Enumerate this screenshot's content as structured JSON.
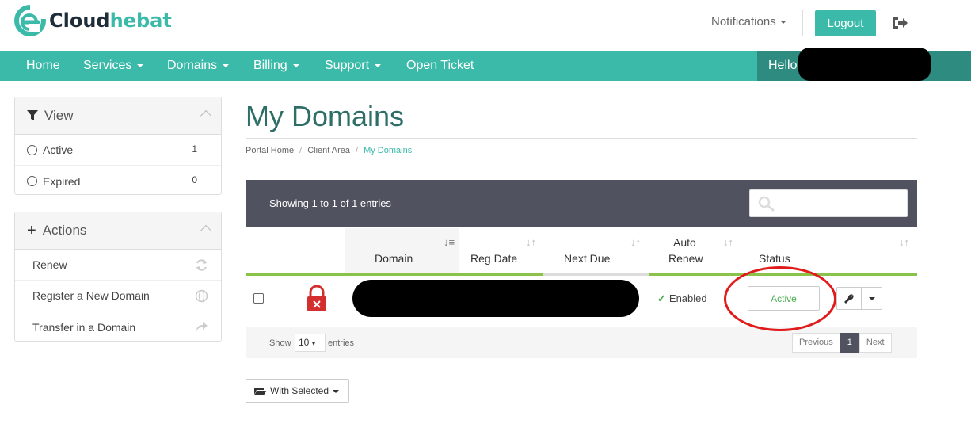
{
  "brand": {
    "name_a": "Cloud",
    "name_b": "hebat"
  },
  "header": {
    "notifications_label": "Notifications",
    "logout_label": "Logout"
  },
  "nav": {
    "items": [
      "Home",
      "Services",
      "Domains",
      "Billing",
      "Support",
      "Open Ticket"
    ],
    "hello_label": "Hello"
  },
  "sidebar": {
    "view": {
      "title": "View",
      "items": [
        {
          "label": "Active",
          "count": "1"
        },
        {
          "label": "Expired",
          "count": "0"
        }
      ]
    },
    "actions": {
      "title": "Actions",
      "items": [
        {
          "label": "Renew",
          "icon": "refresh-icon"
        },
        {
          "label": "Register a New Domain",
          "icon": "globe-icon"
        },
        {
          "label": "Transfer in a Domain",
          "icon": "share-icon"
        }
      ]
    }
  },
  "page": {
    "title": "My Domains",
    "breadcrumb": [
      "Portal Home",
      "Client Area",
      "My Domains"
    ]
  },
  "table": {
    "showing_text": "Showing 1 to 1 of 1 entries",
    "columns": [
      "Domain",
      "Reg Date",
      "Next Due",
      "Auto Renew",
      "Status"
    ],
    "auto_renew_line1": "Auto",
    "auto_renew_line2": "Renew",
    "rows": [
      {
        "auto_renew": "Enabled",
        "status": "Active",
        "lock_icon": "lock-icon"
      }
    ],
    "footer": {
      "show_label": "Show",
      "page_size": "10",
      "entries_label": "entries",
      "prev_label": "Previous",
      "current_page": "1",
      "next_label": "Next"
    },
    "with_selected_label": "With Selected"
  },
  "colors": {
    "accent": "#3bbaa9",
    "accent_dark": "#2e8b80",
    "table_head": "#50535f",
    "status_green": "#4caf50",
    "annotation_red": "#e01b1b"
  }
}
